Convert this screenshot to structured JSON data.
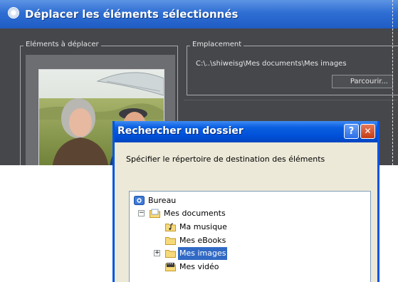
{
  "background_dialog": {
    "title": "Déplacer les éléments sélectionnés",
    "elements_group_label": "Eléments à déplacer",
    "location_group_label": "Emplacement",
    "path": "C:\\..\\shiweisg\\Mes documents\\Mes images",
    "browse_label": "Parcourir..."
  },
  "folder_dialog": {
    "title": "Rechercher un dossier",
    "instruction": "Spécifier le répertoire de destination des éléments",
    "help_glyph": "?",
    "close_glyph": "✕",
    "tree": {
      "root": "Bureau",
      "my_documents": "Mes documents",
      "expander_minus": "−",
      "expander_plus": "+",
      "children": [
        "Ma musique",
        "Mes eBooks",
        "Mes images",
        "Mes vidéo"
      ],
      "selected": "Mes images"
    }
  },
  "colors": {
    "xp_blue": "#0054e3",
    "dark_dialog": "#45474b",
    "selection": "#316ac5"
  }
}
